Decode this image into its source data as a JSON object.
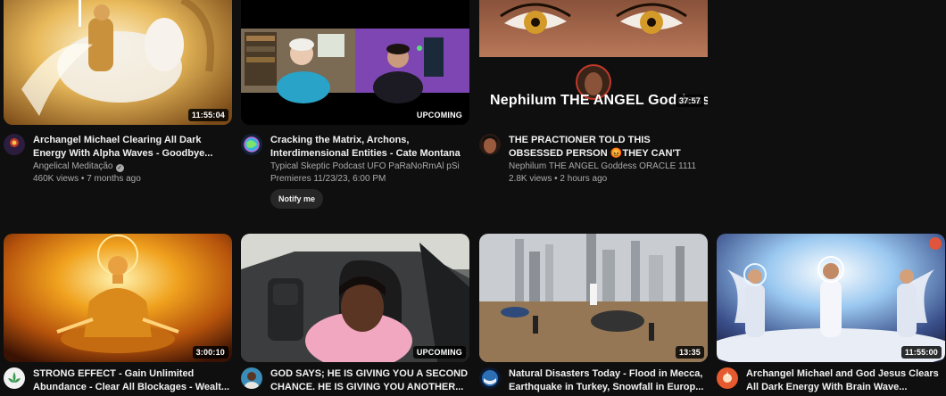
{
  "videos": [
    {
      "title": "Archangel Michael Clearing All Dark Energy With Alpha Waves - Goodbye...",
      "channel": "Angelical Meditação",
      "stats": "460K views • 7 months ago",
      "badge": "11:55:04",
      "avatar_icon": "angel-avatar-icon"
    },
    {
      "title": "Cracking the Matrix, Archons, Interdimensional Entities - Cate Montana",
      "channel": "Typical Skeptic Podcast UFO PaRaNoRmAl pSi",
      "stats": "Premieres 11/23/23, 6:00 PM",
      "badge": "UPCOMING",
      "notify_label": "Notify me",
      "avatar_icon": "globe-avatar-icon"
    },
    {
      "title": "THE PRACTIONER TOLD THIS OBSESSED PERSON 😡THEY CAN'T TOUCH YOU ...",
      "channel": "Nephilum THE ANGEL Goddess ORACLE 1111",
      "stats": "2.8K views • 2 hours ago",
      "badge": "37:57",
      "overlay_text": "Nephilum THE ANGEL Goddess",
      "avatar_icon": "woman-avatar-icon"
    },
    {
      "title": "STRONG EFFECT - Gain Unlimited Abundance - Clear All Blockages - Wealt...",
      "badge": "3:00:10",
      "avatar_icon": "lotus-avatar-icon"
    },
    {
      "title": "GOD SAYS; HE IS GIVING YOU A SECOND CHANCE. HE IS GIVING YOU ANOTHER...",
      "badge": "UPCOMING",
      "avatar_icon": "person-avatar-icon"
    },
    {
      "title": "Natural Disasters Today - Flood in Mecca, Earthquake in Turkey, Snowfall in Europ...",
      "badge": "13:35",
      "avatar_icon": "earth-avatar-icon"
    },
    {
      "title": "Archangel Michael and God Jesus Clears All Dark Energy With Brain Wave...",
      "badge": "11:55:00",
      "avatar_icon": "orange-avatar-icon"
    }
  ],
  "colors": {
    "background": "#0f0f0f",
    "title_text": "#f1f1f1",
    "secondary_text": "#aaaaaa",
    "chip": "#272727"
  }
}
